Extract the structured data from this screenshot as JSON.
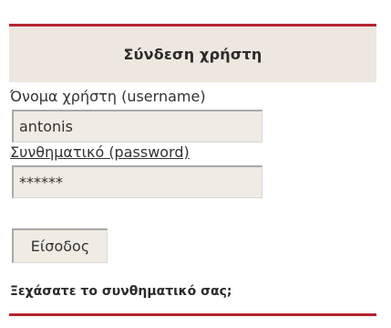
{
  "login_panel": {
    "title": "Σύνδεση χρήστη",
    "username_label": "Όνομα χρήστη (username)",
    "username_value": "antonis",
    "password_label": "Συνθηματικό (password)",
    "password_value": "******",
    "login_button_label": "Είσοδος",
    "forgot_password_link": "Ξεχάσατε το συνθηματικό σας;"
  },
  "colors": {
    "accent": "#b3262f",
    "header_background": "#ede7df",
    "field_background": "#f0ebe3",
    "text": "#333333"
  }
}
